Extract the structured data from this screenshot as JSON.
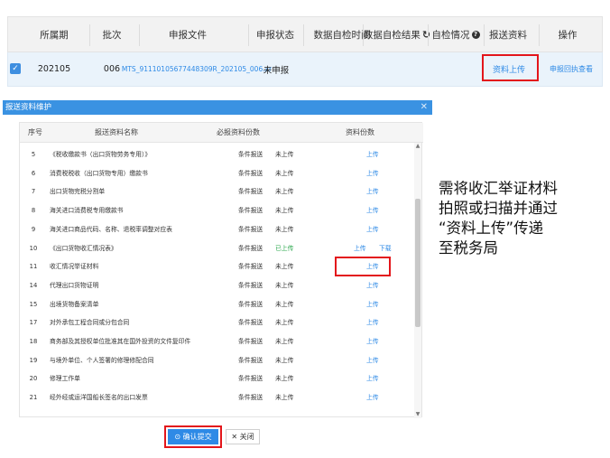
{
  "top_table": {
    "headers": [
      "所属期",
      "批次",
      "申报文件",
      "申报状态",
      "数据自检时间",
      "数据自检结果",
      "自检情况",
      "报送资料",
      "操作"
    ],
    "header_icons": {
      "refresh": "refresh-icon",
      "help": "help-icon"
    },
    "row": {
      "period": "202105",
      "batch": "006",
      "file": "MTS_91110105677448309R_202105_006.xr",
      "status": "未申报",
      "check_time": "",
      "check_result": "",
      "check_detail": "",
      "material": "资料上传",
      "action": "申报回执查看"
    }
  },
  "dialog": {
    "title": "报送资料维护",
    "columns": [
      "序号",
      "报送资料名称",
      "必报资料份数",
      "资料份数"
    ],
    "rows": [
      {
        "no": "5",
        "name": "《税收缴款书（出口货物劳务专用）》",
        "req": "条件报送",
        "status": "未上传",
        "upload": "上传",
        "download": ""
      },
      {
        "no": "6",
        "name": "消费税税收（出口货物专用）缴款书",
        "req": "条件报送",
        "status": "未上传",
        "upload": "上传",
        "download": ""
      },
      {
        "no": "7",
        "name": "出口货物完税分割单",
        "req": "条件报送",
        "status": "未上传",
        "upload": "上传",
        "download": ""
      },
      {
        "no": "8",
        "name": "海关进口消费税专用缴款书",
        "req": "条件报送",
        "status": "未上传",
        "upload": "上传",
        "download": ""
      },
      {
        "no": "9",
        "name": "海关进口商品代码、名称、退税率调整对应表",
        "req": "条件报送",
        "status": "未上传",
        "upload": "上传",
        "download": ""
      },
      {
        "no": "10",
        "name": "《出口货物收汇情况表》",
        "req": "条件报送",
        "status": "已上传",
        "upload": "上传",
        "download": "下载"
      },
      {
        "no": "11",
        "name": "收汇情况举证材料",
        "req": "条件报送",
        "status": "未上传",
        "upload": "上传",
        "download": ""
      },
      {
        "no": "14",
        "name": "代理出口货物证明",
        "req": "条件报送",
        "status": "未上传",
        "upload": "上传",
        "download": ""
      },
      {
        "no": "15",
        "name": "出境货物备案清单",
        "req": "条件报送",
        "status": "未上传",
        "upload": "上传",
        "download": ""
      },
      {
        "no": "17",
        "name": "对外承包工程合同或分包合同",
        "req": "条件报送",
        "status": "未上传",
        "upload": "上传",
        "download": ""
      },
      {
        "no": "18",
        "name": "商务部及其授权单位批准其在国外投资的文件复印件",
        "req": "条件报送",
        "status": "未上传",
        "upload": "上传",
        "download": ""
      },
      {
        "no": "19",
        "name": "与境外单位、个人签署的修理修配合同",
        "req": "条件报送",
        "status": "未上传",
        "upload": "上传",
        "download": ""
      },
      {
        "no": "20",
        "name": "修理工作单",
        "req": "条件报送",
        "status": "未上传",
        "upload": "上传",
        "download": ""
      },
      {
        "no": "21",
        "name": "经外经或运洋国船长签名的出口发票",
        "req": "条件报送",
        "status": "未上传",
        "upload": "上传",
        "download": ""
      }
    ],
    "confirm_label": "确认提交",
    "close_label": "关闭"
  },
  "annotation": {
    "lines": [
      "需将收汇举证材料",
      "拍照或扫描并通过",
      "“资料上传”传递",
      "至税务局"
    ]
  },
  "colors": {
    "accent": "#2e8ae6",
    "highlight": "#e3161b",
    "success": "#2da84f"
  }
}
